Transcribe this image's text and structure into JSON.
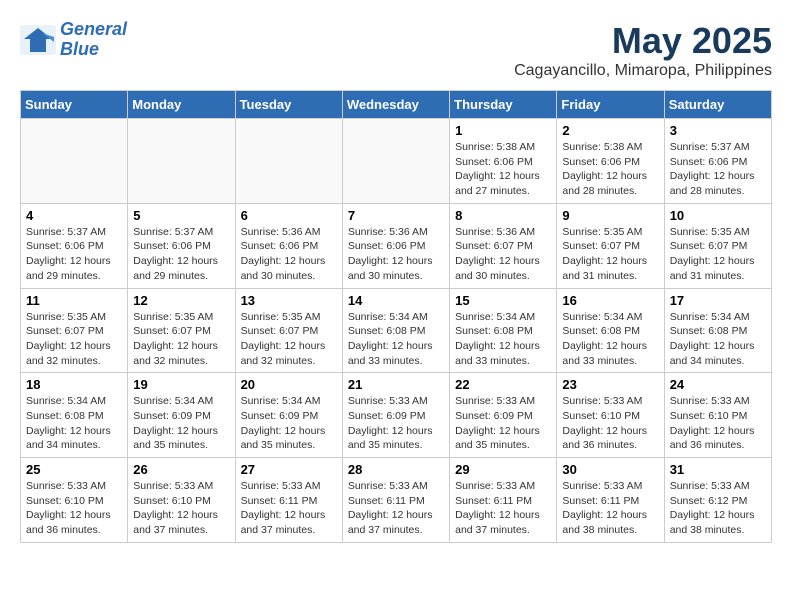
{
  "logo": {
    "line1": "General",
    "line2": "Blue"
  },
  "title": "May 2025",
  "subtitle": "Cagayancillo, Mimaropa, Philippines",
  "headers": [
    "Sunday",
    "Monday",
    "Tuesday",
    "Wednesday",
    "Thursday",
    "Friday",
    "Saturday"
  ],
  "weeks": [
    [
      {
        "day": "",
        "info": ""
      },
      {
        "day": "",
        "info": ""
      },
      {
        "day": "",
        "info": ""
      },
      {
        "day": "",
        "info": ""
      },
      {
        "day": "1",
        "info": "Sunrise: 5:38 AM\nSunset: 6:06 PM\nDaylight: 12 hours\nand 27 minutes."
      },
      {
        "day": "2",
        "info": "Sunrise: 5:38 AM\nSunset: 6:06 PM\nDaylight: 12 hours\nand 28 minutes."
      },
      {
        "day": "3",
        "info": "Sunrise: 5:37 AM\nSunset: 6:06 PM\nDaylight: 12 hours\nand 28 minutes."
      }
    ],
    [
      {
        "day": "4",
        "info": "Sunrise: 5:37 AM\nSunset: 6:06 PM\nDaylight: 12 hours\nand 29 minutes."
      },
      {
        "day": "5",
        "info": "Sunrise: 5:37 AM\nSunset: 6:06 PM\nDaylight: 12 hours\nand 29 minutes."
      },
      {
        "day": "6",
        "info": "Sunrise: 5:36 AM\nSunset: 6:06 PM\nDaylight: 12 hours\nand 30 minutes."
      },
      {
        "day": "7",
        "info": "Sunrise: 5:36 AM\nSunset: 6:06 PM\nDaylight: 12 hours\nand 30 minutes."
      },
      {
        "day": "8",
        "info": "Sunrise: 5:36 AM\nSunset: 6:07 PM\nDaylight: 12 hours\nand 30 minutes."
      },
      {
        "day": "9",
        "info": "Sunrise: 5:35 AM\nSunset: 6:07 PM\nDaylight: 12 hours\nand 31 minutes."
      },
      {
        "day": "10",
        "info": "Sunrise: 5:35 AM\nSunset: 6:07 PM\nDaylight: 12 hours\nand 31 minutes."
      }
    ],
    [
      {
        "day": "11",
        "info": "Sunrise: 5:35 AM\nSunset: 6:07 PM\nDaylight: 12 hours\nand 32 minutes."
      },
      {
        "day": "12",
        "info": "Sunrise: 5:35 AM\nSunset: 6:07 PM\nDaylight: 12 hours\nand 32 minutes."
      },
      {
        "day": "13",
        "info": "Sunrise: 5:35 AM\nSunset: 6:07 PM\nDaylight: 12 hours\nand 32 minutes."
      },
      {
        "day": "14",
        "info": "Sunrise: 5:34 AM\nSunset: 6:08 PM\nDaylight: 12 hours\nand 33 minutes."
      },
      {
        "day": "15",
        "info": "Sunrise: 5:34 AM\nSunset: 6:08 PM\nDaylight: 12 hours\nand 33 minutes."
      },
      {
        "day": "16",
        "info": "Sunrise: 5:34 AM\nSunset: 6:08 PM\nDaylight: 12 hours\nand 33 minutes."
      },
      {
        "day": "17",
        "info": "Sunrise: 5:34 AM\nSunset: 6:08 PM\nDaylight: 12 hours\nand 34 minutes."
      }
    ],
    [
      {
        "day": "18",
        "info": "Sunrise: 5:34 AM\nSunset: 6:08 PM\nDaylight: 12 hours\nand 34 minutes."
      },
      {
        "day": "19",
        "info": "Sunrise: 5:34 AM\nSunset: 6:09 PM\nDaylight: 12 hours\nand 35 minutes."
      },
      {
        "day": "20",
        "info": "Sunrise: 5:34 AM\nSunset: 6:09 PM\nDaylight: 12 hours\nand 35 minutes."
      },
      {
        "day": "21",
        "info": "Sunrise: 5:33 AM\nSunset: 6:09 PM\nDaylight: 12 hours\nand 35 minutes."
      },
      {
        "day": "22",
        "info": "Sunrise: 5:33 AM\nSunset: 6:09 PM\nDaylight: 12 hours\nand 35 minutes."
      },
      {
        "day": "23",
        "info": "Sunrise: 5:33 AM\nSunset: 6:10 PM\nDaylight: 12 hours\nand 36 minutes."
      },
      {
        "day": "24",
        "info": "Sunrise: 5:33 AM\nSunset: 6:10 PM\nDaylight: 12 hours\nand 36 minutes."
      }
    ],
    [
      {
        "day": "25",
        "info": "Sunrise: 5:33 AM\nSunset: 6:10 PM\nDaylight: 12 hours\nand 36 minutes."
      },
      {
        "day": "26",
        "info": "Sunrise: 5:33 AM\nSunset: 6:10 PM\nDaylight: 12 hours\nand 37 minutes."
      },
      {
        "day": "27",
        "info": "Sunrise: 5:33 AM\nSunset: 6:11 PM\nDaylight: 12 hours\nand 37 minutes."
      },
      {
        "day": "28",
        "info": "Sunrise: 5:33 AM\nSunset: 6:11 PM\nDaylight: 12 hours\nand 37 minutes."
      },
      {
        "day": "29",
        "info": "Sunrise: 5:33 AM\nSunset: 6:11 PM\nDaylight: 12 hours\nand 37 minutes."
      },
      {
        "day": "30",
        "info": "Sunrise: 5:33 AM\nSunset: 6:11 PM\nDaylight: 12 hours\nand 38 minutes."
      },
      {
        "day": "31",
        "info": "Sunrise: 5:33 AM\nSunset: 6:12 PM\nDaylight: 12 hours\nand 38 minutes."
      }
    ]
  ]
}
